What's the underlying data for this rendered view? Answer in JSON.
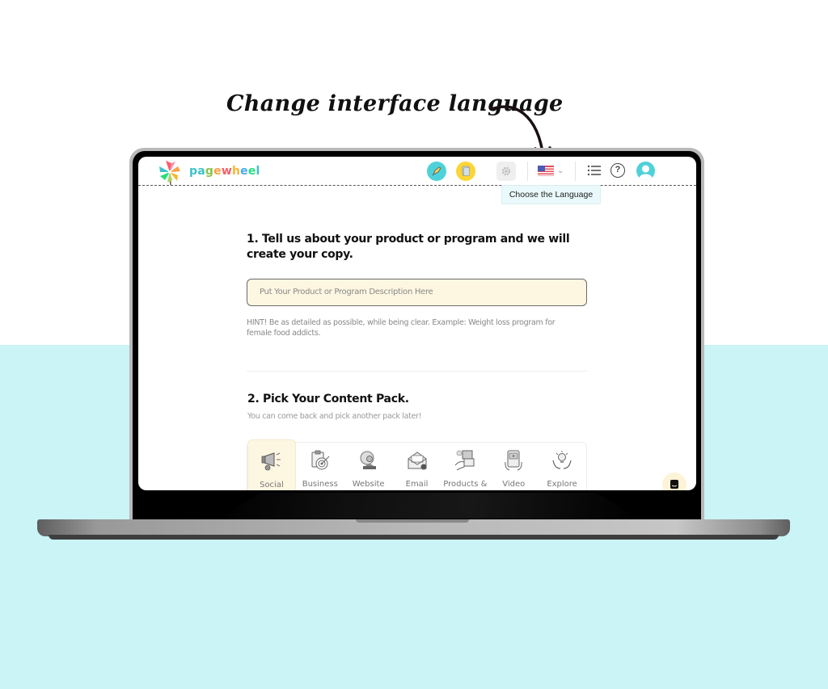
{
  "annotation": {
    "text": "Change interface language"
  },
  "header": {
    "brand": [
      "p",
      "a",
      "g",
      "e",
      "w",
      "h",
      "e",
      "e",
      "l"
    ],
    "brand_colors": [
      "#3fc1c9",
      "#3fc1c9",
      "#8bc34a",
      "#ff9f43",
      "#fc5c65",
      "#f7b731",
      "#45aaf2",
      "#26de81",
      "#3fc1c9"
    ],
    "icons": {
      "rocket": "rocket-icon",
      "document": "document-icon",
      "settings": "gear-icon",
      "language": "us-flag-icon",
      "menu": "list-icon",
      "help": "help-icon",
      "user": "user-avatar-icon"
    },
    "help_glyph": "?",
    "chevron_glyph": "⌄",
    "colors": {
      "rocket_bg": "#4fd1da",
      "doc_bg": "#fcd535",
      "avatar_bg": "#4fd1da"
    }
  },
  "tooltip": {
    "text": "Choose the Language"
  },
  "step1": {
    "title": "1. Tell us about your product or program and we will create your copy.",
    "input_placeholder": "Put Your Product or Program Description Here",
    "input_value": "",
    "hint": "HINT! Be as detailed as possible, while being clear. Example: Weight loss program for female food addicts."
  },
  "step2": {
    "title": "2. Pick Your Content Pack.",
    "subtitle": "You can come back and pick another pack later!",
    "packs": [
      {
        "label": "Social Content",
        "icon": "megaphone-icon",
        "active": true
      },
      {
        "label": "Business Branding",
        "icon": "target-clipboard-icon",
        "active": false
      },
      {
        "label": "Website and/or",
        "icon": "web-developer-icon",
        "active": false
      },
      {
        "label": "Email Marketing",
        "icon": "email-icon",
        "active": false
      },
      {
        "label": "Products &",
        "icon": "product-card-icon",
        "active": false
      },
      {
        "label": "Video Scripts",
        "icon": "video-tablet-icon",
        "active": false
      },
      {
        "label": "Explore",
        "icon": "lightbulb-hands-icon",
        "active": false
      }
    ]
  },
  "chat": {
    "icon": "chat-icon"
  },
  "colors": {
    "background_lower": "#caf4f6",
    "input_bg": "#fdf6e1",
    "tooltip_bg": "#eaf9fb"
  }
}
